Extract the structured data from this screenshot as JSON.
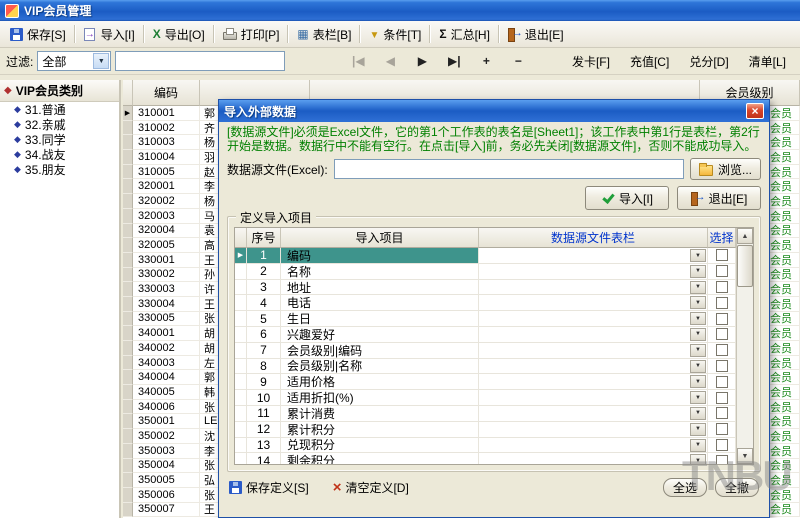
{
  "window": {
    "title": "VIP会员管理"
  },
  "colors": {
    "instruction_green": "#008000",
    "header_link_blue": "#0033CC",
    "selected_row_teal": "#3E948C",
    "level_text_green": "#1E8B1E"
  },
  "toolbar": {
    "buttons": [
      {
        "label": "保存[S]",
        "icon": "save-icon"
      },
      {
        "label": "导入[I]",
        "icon": "import-icon"
      },
      {
        "label": "导出[O]",
        "icon": "excel-export-icon"
      },
      {
        "label": "打印[P]",
        "icon": "printer-icon"
      },
      {
        "label": "表栏[B]",
        "icon": "columns-icon"
      },
      {
        "label": "条件[T]",
        "icon": "condition-filter-icon"
      },
      {
        "label": "汇总[H]",
        "icon": "sum-sigma-icon"
      },
      {
        "label": "退出[E]",
        "icon": "exit-icon"
      }
    ]
  },
  "filter_bar": {
    "label": "过滤:",
    "category_value": "全部",
    "search_value": "",
    "nav_buttons": [
      {
        "glyph": "|◀"
      },
      {
        "glyph": "◀"
      },
      {
        "glyph": "▶"
      },
      {
        "glyph": "▶|"
      },
      {
        "glyph": "+"
      },
      {
        "glyph": "−"
      }
    ],
    "actions": [
      "发卡[F]",
      "充值[C]",
      "兑分[D]",
      "清单[L]"
    ]
  },
  "sidebar": {
    "header": "VIP会员类别",
    "items": [
      "31.普通",
      "32.亲戚",
      "33.同学",
      "34.战友",
      "35.朋友"
    ]
  },
  "grid": {
    "columns": {
      "code": "编码",
      "level": "会员级别"
    },
    "rows": [
      {
        "code": "310001",
        "name": "郭",
        "level": "会员"
      },
      {
        "code": "310002",
        "name": "齐",
        "level": "会员"
      },
      {
        "code": "310003",
        "name": "杨",
        "level": "会员"
      },
      {
        "code": "310004",
        "name": "羽",
        "level": "会员"
      },
      {
        "code": "310005",
        "name": "赵",
        "level": "会员"
      },
      {
        "code": "320001",
        "name": "李",
        "level": "会员"
      },
      {
        "code": "320002",
        "name": "杨",
        "level": "会员"
      },
      {
        "code": "320003",
        "name": "马",
        "level": "会员"
      },
      {
        "code": "320004",
        "name": "袁",
        "level": "会员"
      },
      {
        "code": "320005",
        "name": "高",
        "level": "会员"
      },
      {
        "code": "330001",
        "name": "王",
        "level": "会员"
      },
      {
        "code": "330002",
        "name": "孙",
        "level": "会员"
      },
      {
        "code": "330003",
        "name": "许",
        "level": "会员"
      },
      {
        "code": "330004",
        "name": "王",
        "level": "会员"
      },
      {
        "code": "330005",
        "name": "张",
        "level": "会员"
      },
      {
        "code": "340001",
        "name": "胡",
        "level": "会员"
      },
      {
        "code": "340002",
        "name": "胡",
        "level": "会员"
      },
      {
        "code": "340003",
        "name": "左",
        "level": "会员"
      },
      {
        "code": "340004",
        "name": "郭",
        "level": "会员"
      },
      {
        "code": "340005",
        "name": "韩",
        "level": "会员"
      },
      {
        "code": "340006",
        "name": "张",
        "level": "会员"
      },
      {
        "code": "350001",
        "name": "LE",
        "level": "会员"
      },
      {
        "code": "350002",
        "name": "沈",
        "level": "会员"
      },
      {
        "code": "350003",
        "name": "李",
        "level": "会员"
      },
      {
        "code": "350004",
        "name": "张",
        "level": "会员"
      },
      {
        "code": "350005",
        "name": "弘",
        "level": "会员"
      },
      {
        "code": "350006",
        "name": "张",
        "level": "会员"
      },
      {
        "code": "350007",
        "name": "王",
        "level": "会员"
      }
    ]
  },
  "dialog": {
    "title": "导入外部数据",
    "close_glyph": "×",
    "instructions": "[数据源文件]必须是Excel文件，它的第1个工作表的表名是[Sheet1]；该工作表中第1行是表栏，第2行开始是数据。数据行中不能有空行。在点击[导入]前，务必先关闭[数据源文件]，否则不能成功导入。",
    "source_label": "数据源文件(Excel):",
    "source_value": "",
    "browse_label": "浏览...",
    "import_label": "导入[I]",
    "exit_label": "退出[E]",
    "group_title": "定义导入项目",
    "grid": {
      "headers": {
        "no": "序号",
        "item": "导入项目",
        "source_col": "数据源文件表栏",
        "select": "选择"
      },
      "rows": [
        {
          "no": "1",
          "item": "编码"
        },
        {
          "no": "2",
          "item": "名称"
        },
        {
          "no": "3",
          "item": "地址"
        },
        {
          "no": "4",
          "item": "电话"
        },
        {
          "no": "5",
          "item": "生日"
        },
        {
          "no": "6",
          "item": "兴趣爱好"
        },
        {
          "no": "7",
          "item": "会员级别|编码"
        },
        {
          "no": "8",
          "item": "会员级别|名称"
        },
        {
          "no": "9",
          "item": "适用价格"
        },
        {
          "no": "10",
          "item": "适用折扣(%)"
        },
        {
          "no": "11",
          "item": "累计消费"
        },
        {
          "no": "12",
          "item": "累计积分"
        },
        {
          "no": "13",
          "item": "兑现积分"
        },
        {
          "no": "14",
          "item": "剩余积分"
        }
      ]
    },
    "save_def_label": "保存定义[S]",
    "clear_def_label": "清空定义[D]",
    "select_all_label": "全选",
    "deselect_all_label": "全撤"
  },
  "watermark": "TNBU"
}
